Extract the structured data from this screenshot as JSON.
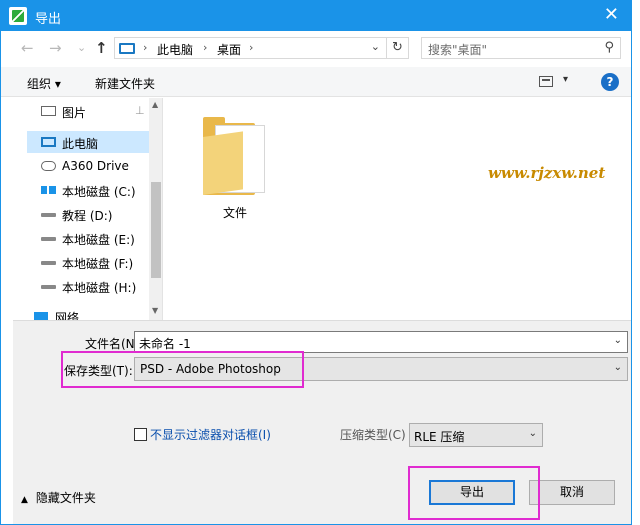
{
  "window": {
    "title": "导出",
    "close_glyph": "✕"
  },
  "nav": {
    "back": "←",
    "forward": "→",
    "recent": "⌄",
    "up": "↑"
  },
  "address": {
    "crumbs": [
      "此电脑",
      "桌面"
    ],
    "sep": "›",
    "dropdown": "⌄",
    "refresh": "↻"
  },
  "search": {
    "placeholder": "搜索\"桌面\"",
    "icon": "⚲"
  },
  "toolbar": {
    "organize": "组织 ▾",
    "new_folder": "新建文件夹",
    "view_drop": "▾",
    "help": "?"
  },
  "sidebar": {
    "items": [
      {
        "label": "图片",
        "icon": "pictures-icon"
      },
      {
        "label": "此电脑",
        "icon": "this-pc-icon",
        "selected": true
      },
      {
        "label": "A360 Drive",
        "icon": "cloud-drive-icon"
      },
      {
        "label": "本地磁盘 (C:)",
        "icon": "windows-drive-icon"
      },
      {
        "label": "教程 (D:)",
        "icon": "drive-icon"
      },
      {
        "label": "本地磁盘 (E:)",
        "icon": "drive-icon"
      },
      {
        "label": "本地磁盘 (F:)",
        "icon": "drive-icon"
      },
      {
        "label": "本地磁盘 (H:)",
        "icon": "drive-icon"
      },
      {
        "label": "网络",
        "icon": "network-icon"
      }
    ],
    "pin_glyph": "📌"
  },
  "files": [
    {
      "name": "文件",
      "type": "folder"
    }
  ],
  "watermark": "www.rjzxw.net",
  "form": {
    "filename_label": "文件名(N):",
    "filename_value": "未命名 -1",
    "filetype_label": "保存类型(T):",
    "filetype_value": "PSD - Adobe Photoshop",
    "no_filter_dialog_label": "不显示过滤器对话框(I)",
    "compression_label": "压缩类型(C)",
    "compression_value": "RLE 压缩",
    "dropdown_glyph": "⌄"
  },
  "footer": {
    "hide_folders": "隐藏文件夹",
    "export_button": "导出",
    "cancel_button": "取消"
  },
  "colors": {
    "titlebar": "#1a93e8",
    "highlight": "#e02bd0",
    "selection": "#cce8ff",
    "link": "#0a4fad"
  }
}
